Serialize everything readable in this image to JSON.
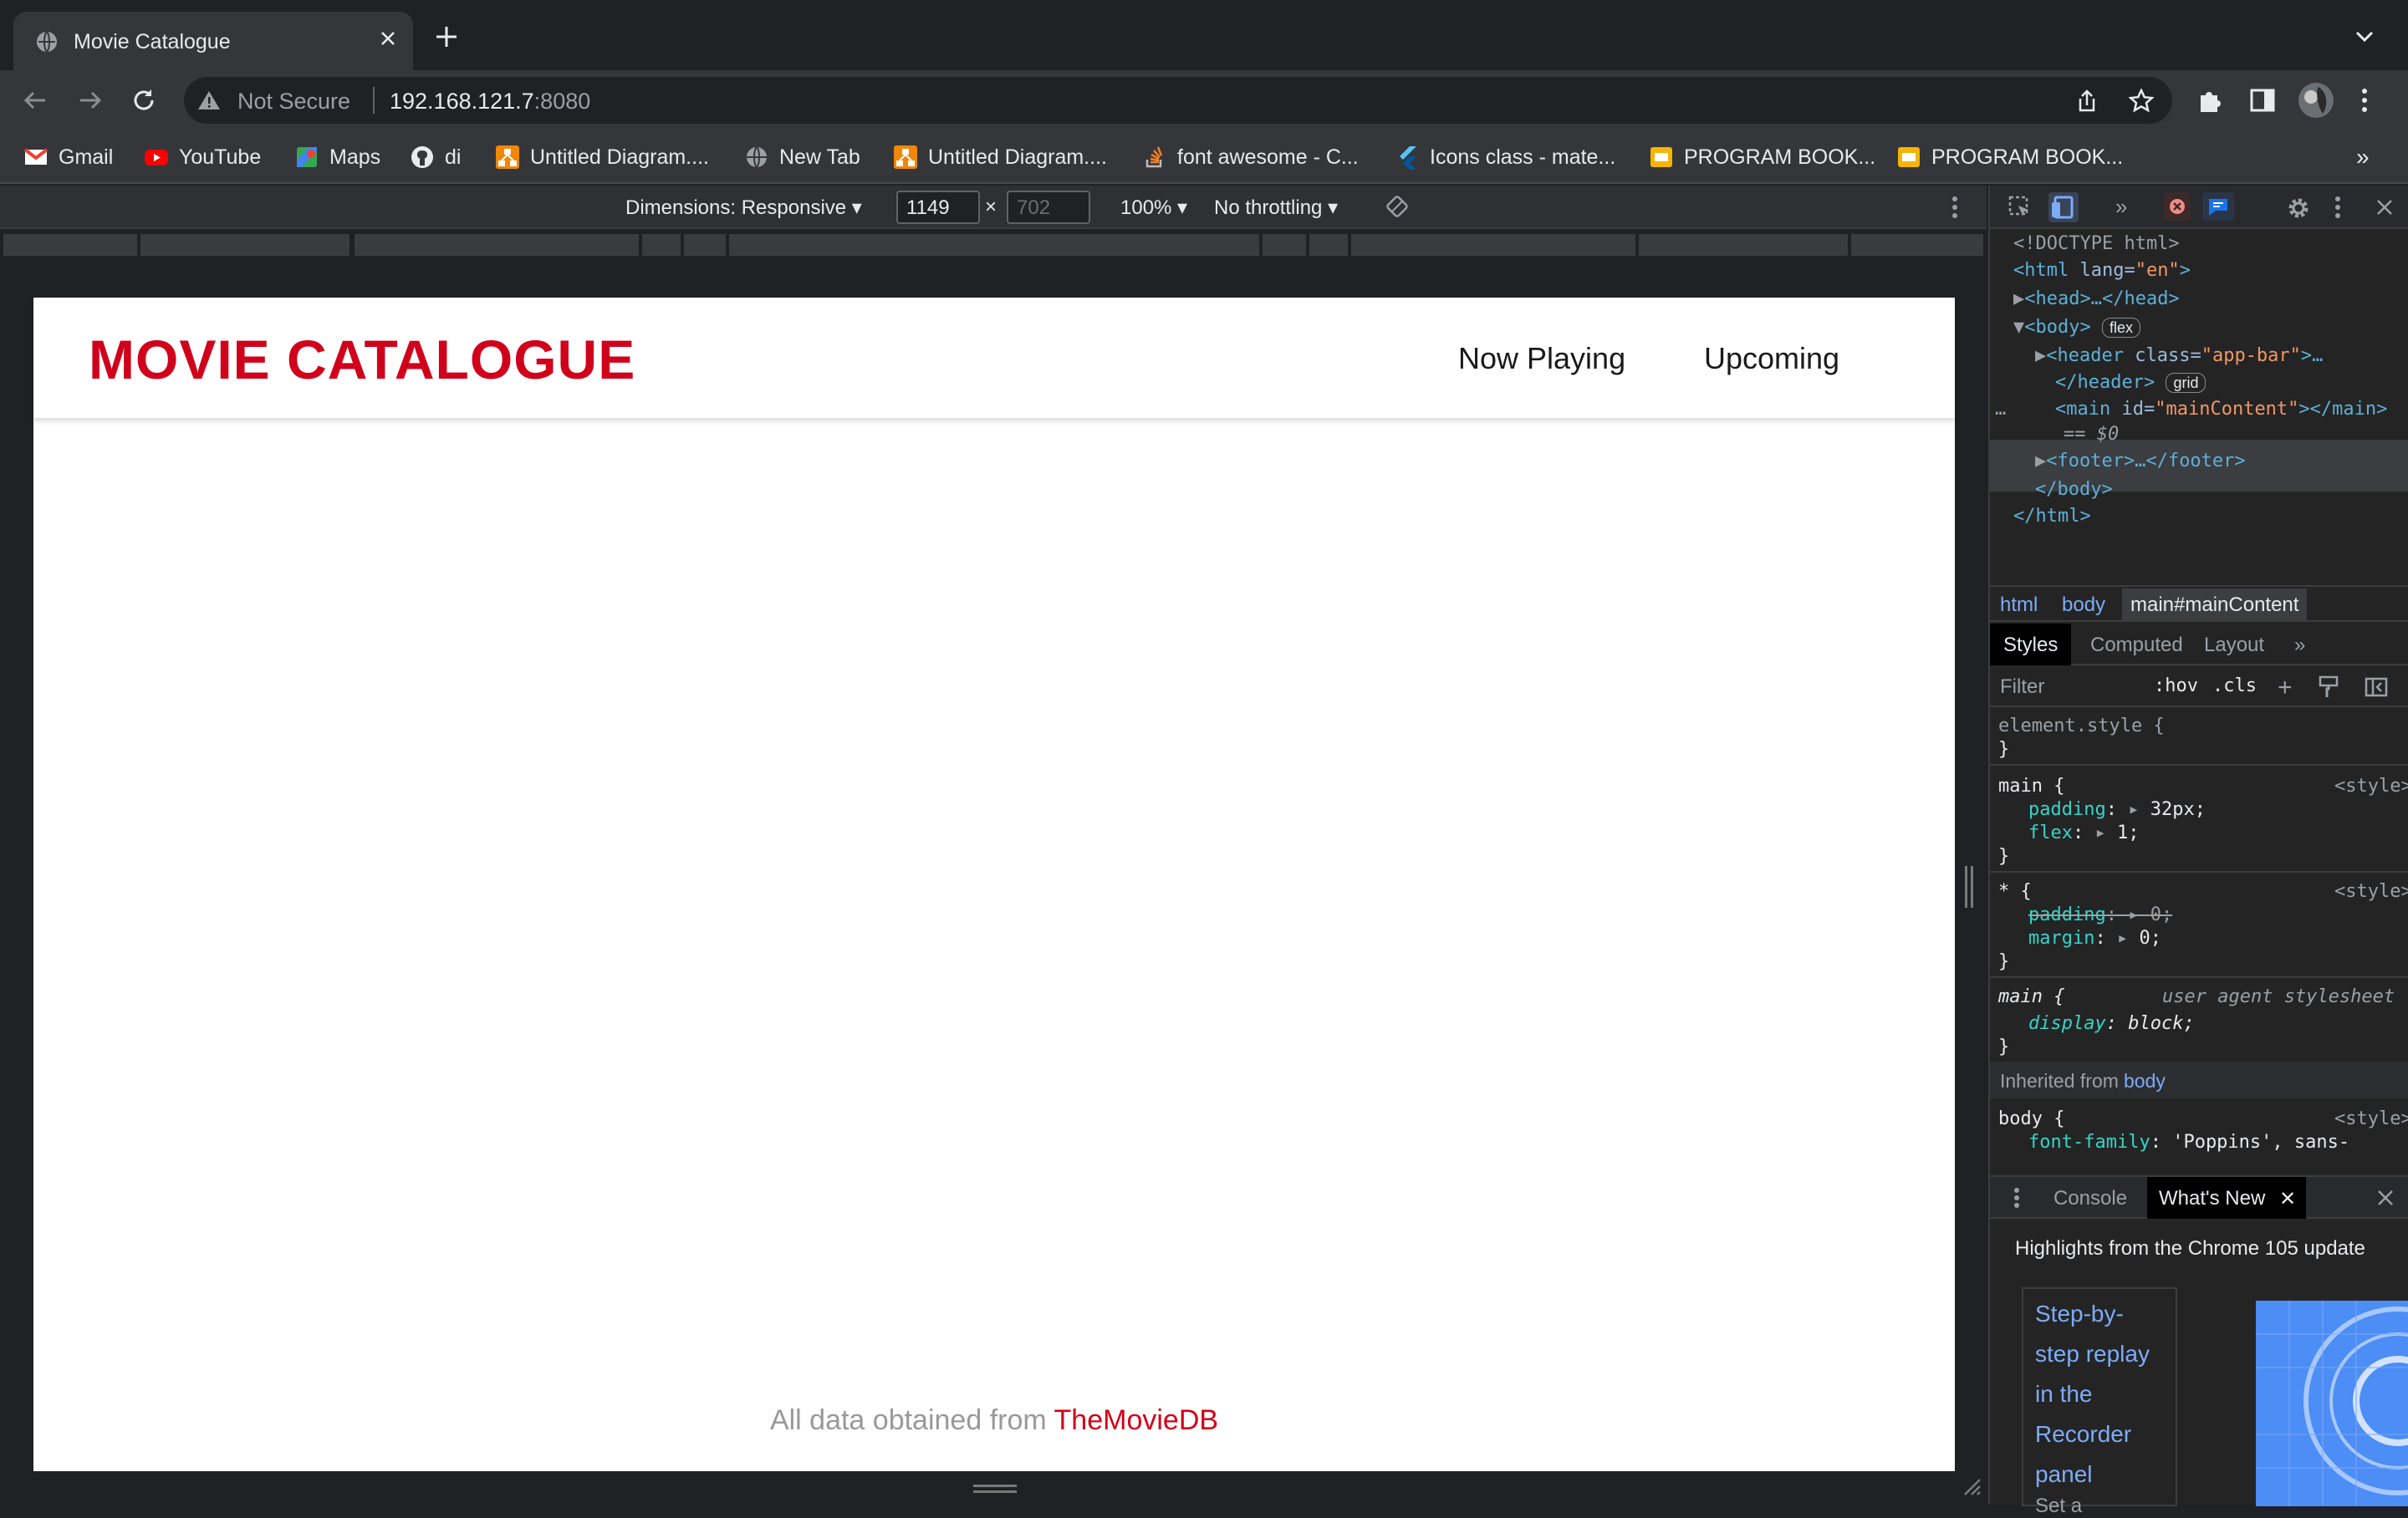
{
  "browser": {
    "tab_title": "Movie Catalogue",
    "not_secure": "Not Secure",
    "url_host": "192.168.121.7",
    "url_port": ":8080"
  },
  "bookmarks": [
    {
      "label": "Gmail"
    },
    {
      "label": "YouTube"
    },
    {
      "label": "Maps"
    },
    {
      "label": "di"
    },
    {
      "label": "Untitled Diagram...."
    },
    {
      "label": "New Tab"
    },
    {
      "label": "Untitled Diagram...."
    },
    {
      "label": "font awesome - C..."
    },
    {
      "label": "Icons class - mate..."
    },
    {
      "label": "PROGRAM BOOK..."
    },
    {
      "label": "PROGRAM BOOK..."
    }
  ],
  "bookmarks_more": "»",
  "device_toolbar": {
    "dimensions": "Dimensions: Responsive",
    "width": "1149",
    "height": "702",
    "times": "×",
    "zoom": "100%",
    "throttling": "No throttling"
  },
  "page": {
    "brand": "MOVIE CATALOGUE",
    "nav": [
      "Now Playing",
      "Upcoming"
    ],
    "footer_prefix": "All data obtained from ",
    "footer_link": "TheMovieDB"
  },
  "devtools": {
    "elements": {
      "doctype": "<!DOCTYPE html>",
      "html_open": "<html",
      "lang_attr": "lang",
      "lang_val": "\"en\"",
      "head": "<head>…</head>",
      "body_open": "<body>",
      "flex_badge": "flex",
      "header_open": "<header",
      "class_attr": "class",
      "header_class": "\"app-bar\"",
      "header_tail": ">…",
      "header_close": "</header>",
      "grid_badge": "grid",
      "main_open": "<main",
      "id_attr": "id",
      "main_id": "\"mainContent\"",
      "main_close": "></main>",
      "eq0": "== $0",
      "footer": "<footer>…</footer>",
      "body_close": "</body>",
      "html_close": "</html>",
      "ellipsis": "…"
    },
    "crumbs": [
      "html",
      "body",
      "main#mainContent"
    ],
    "subtabs": [
      "Styles",
      "Computed",
      "Layout"
    ],
    "filter_placeholder": "Filter",
    "hov": ":hov",
    "cls": ".cls",
    "styles": {
      "element_style": "element.style {",
      "close": "}",
      "main_sel": "main {",
      "src_style": "<style>",
      "padding_prop": "padding",
      "padding_val": "32px;",
      "flex_prop": "flex",
      "flex_val": "1;",
      "star_sel": "* {",
      "padding0_val": "0;",
      "margin_prop": "margin",
      "margin_val": "0;",
      "main_ua_sel": "main {",
      "ua_src": "user agent stylesheet",
      "display_prop": "display",
      "display_val": "block;",
      "inherited_from": "Inherited from",
      "inherited_el": "body",
      "body_sel": "body {",
      "font_prop": "font-family",
      "font_val": "'Poppins', sans-"
    },
    "drawer": {
      "tabs": [
        "Console",
        "What's New"
      ],
      "headline": "Highlights from the Chrome 105 update",
      "card_title": "Step-by-step replay in the Recorder panel",
      "card_lines": [
        "Step-by-",
        "step replay",
        "in the",
        "Recorder",
        "panel"
      ],
      "card_sub": "Set a"
    }
  },
  "colors": {
    "brand_red": "#d0021b",
    "devtools_bg": "#242424",
    "chrome_bg": "#202124"
  }
}
